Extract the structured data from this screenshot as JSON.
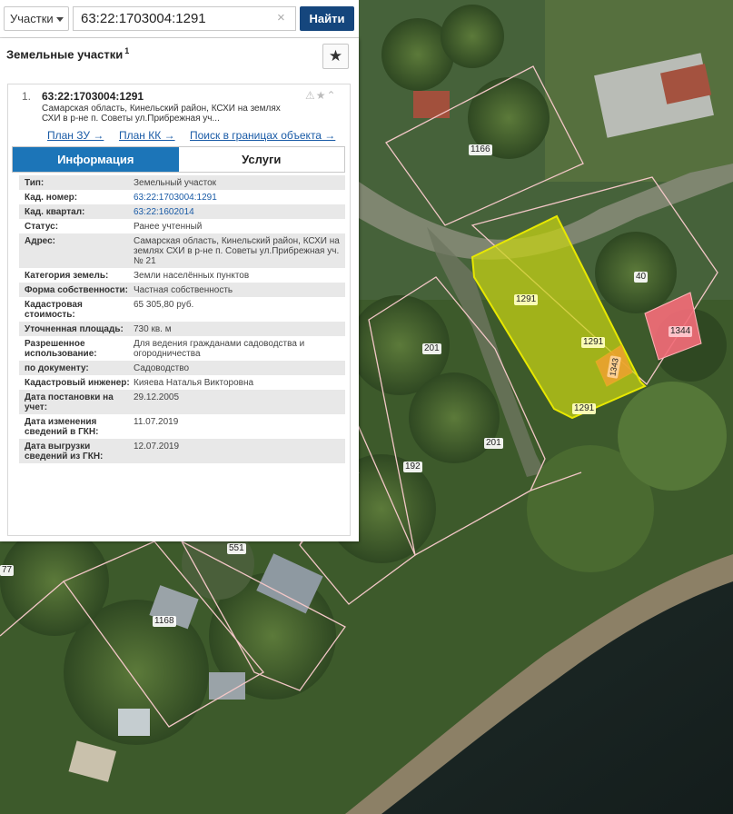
{
  "search": {
    "type_label": "Участки",
    "query": "63:22:1703004:1291",
    "clear_glyph": "×",
    "find_label": "Найти"
  },
  "panel": {
    "title": "Земельные участки",
    "count": "1",
    "favorite_glyph": "★"
  },
  "result": {
    "index": "1.",
    "title": "63:22:1703004:1291",
    "action_glyphs": "⚠★⌃",
    "address_line": "Самарская область, Кинельский район, КСХИ на землях СХИ в р-не п. Советы ул.Прибрежная уч...",
    "links": {
      "plan_zu": "План ЗУ →",
      "plan_kk": "План КК →",
      "search_bounds": "Поиск в границах объекта →"
    },
    "tabs": {
      "info": "Информация",
      "services": "Услуги"
    },
    "properties": [
      {
        "key": "Тип:",
        "value": "Земельный участок"
      },
      {
        "key": "Кад. номер:",
        "value": "63:22:1703004:1291"
      },
      {
        "key": "Кад. квартал:",
        "value": "63:22:1602014"
      },
      {
        "key": "Статус:",
        "value": "Ранее учтенный"
      },
      {
        "key": "Адрес:",
        "value": "Самарская область, Кинельский район, КСХИ на землях СХИ в р-не п. Советы ул.Прибрежная уч. № 21"
      },
      {
        "key": "Категория земель:",
        "value": "Земли населённых пунктов"
      },
      {
        "key": "Форма собственности:",
        "value": "Частная собственность"
      },
      {
        "key": "Кадастровая стоимость:",
        "value": "65 305,80 руб."
      },
      {
        "key": "Уточненная площадь:",
        "value": "730 кв. м"
      },
      {
        "key": "Разрешенное использование:",
        "value": "Для ведения гражданами садоводства и огородничества"
      },
      {
        "key": "по документу:",
        "value": "Садоводство"
      },
      {
        "key": "Кадастровый инженер:",
        "value": "Кияева Наталья Викторовна"
      },
      {
        "key": "Дата постановки на учет:",
        "value": "29.12.2005"
      },
      {
        "key": "Дата изменения сведений в ГКН:",
        "value": "11.07.2019"
      },
      {
        "key": "Дата выгрузки сведений из ГКН:",
        "value": "12.07.2019"
      }
    ]
  },
  "map": {
    "labels": [
      "1166",
      "1291",
      "1291",
      "1291",
      "40",
      "1344",
      "1343",
      "201",
      "201",
      "192",
      "551",
      "1168",
      "77"
    ],
    "colors": {
      "selected_fill": "#c8d414",
      "selected_stroke": "#e8e800",
      "neighbor_fill": "#f26d78",
      "small_fill": "#f0a030",
      "boundary": "#f3c7c7"
    }
  }
}
